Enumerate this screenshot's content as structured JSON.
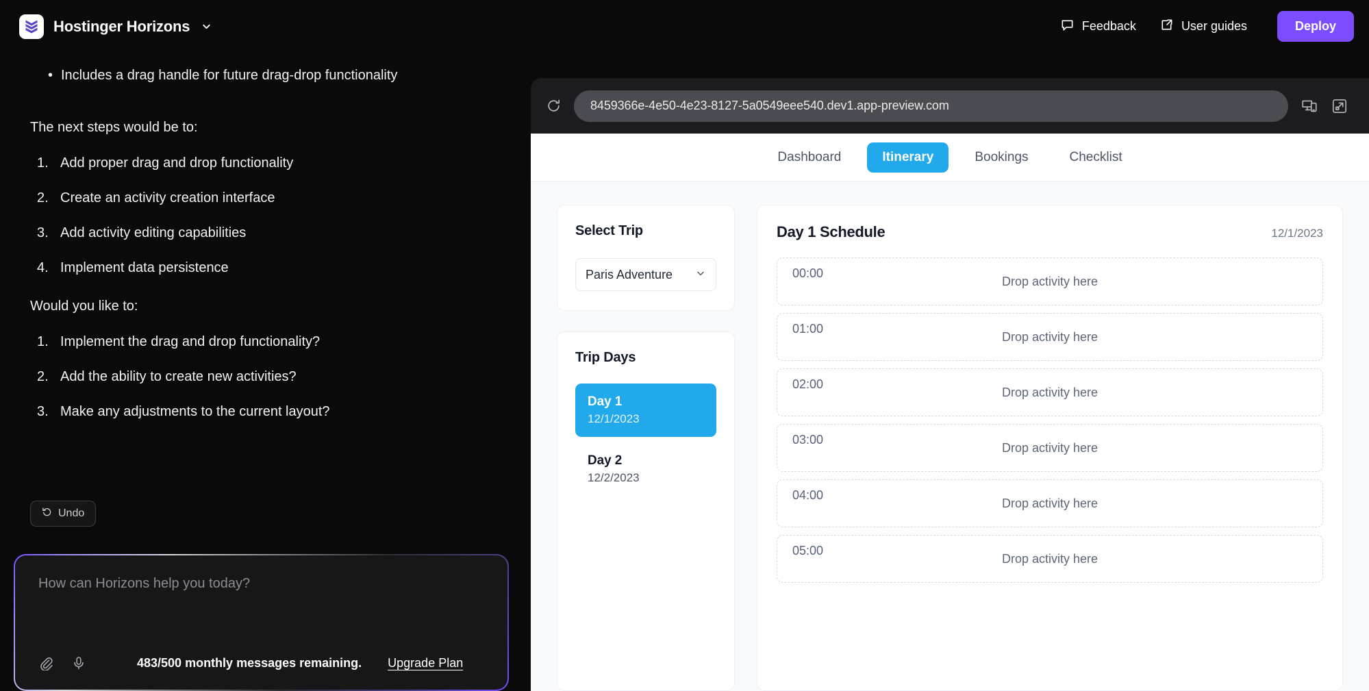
{
  "topbar": {
    "brand_title": "Hostinger Horizons",
    "logo_icon": "hostinger-logo-icon",
    "brand_chevron_icon": "chevron-down-icon",
    "feedback_label": "Feedback",
    "feedback_icon": "chat-bubble-icon",
    "user_guides_label": "User guides",
    "user_guides_icon": "external-link-icon",
    "deploy_label": "Deploy",
    "deploy_color": "#7c4dff"
  },
  "chat": {
    "bullets": [
      "Includes a drag handle for future drag-drop functionality"
    ],
    "next_steps_heading": "The next steps would be to:",
    "next_steps": [
      "Add proper drag and drop functionality",
      "Create an activity creation interface",
      "Add activity editing capabilities",
      "Implement data persistence"
    ],
    "would_you_like_heading": "Would you like to:",
    "would_you_like": [
      "Implement the drag and drop functionality?",
      "Add the ability to create new activities?",
      "Make any adjustments to the current layout?"
    ],
    "undo_label": "Undo",
    "undo_icon": "rotate-left-icon",
    "composer": {
      "placeholder": "How can Horizons help you today?",
      "value": "",
      "attach_icon": "paperclip-icon",
      "mic_icon": "microphone-icon",
      "quota_text": "483/500 monthly messages remaining.",
      "upgrade_label": "Upgrade Plan"
    }
  },
  "preview": {
    "refresh_icon": "refresh-icon",
    "url": "8459366e-4e50-4e23-8127-5a0549eee540.dev1.app-preview.com",
    "device_icon": "device-preview-icon",
    "expand_icon": "open-external-icon"
  },
  "app": {
    "tabs": [
      {
        "label": "Dashboard",
        "active": false
      },
      {
        "label": "Itinerary",
        "active": true
      },
      {
        "label": "Bookings",
        "active": false
      },
      {
        "label": "Checklist",
        "active": false
      }
    ],
    "accent_color": "#21a9ec",
    "select_trip": {
      "title": "Select Trip",
      "selected": "Paris Adventure",
      "chevron_icon": "chevron-down-icon"
    },
    "trip_days": {
      "title": "Trip Days",
      "items": [
        {
          "name": "Day 1",
          "date": "12/1/2023",
          "selected": true
        },
        {
          "name": "Day 2",
          "date": "12/2/2023",
          "selected": false
        }
      ]
    },
    "schedule": {
      "title": "Day 1 Schedule",
      "date": "12/1/2023",
      "drop_label": "Drop activity here",
      "slots": [
        "00:00",
        "01:00",
        "02:00",
        "03:00",
        "04:00",
        "05:00"
      ]
    }
  }
}
